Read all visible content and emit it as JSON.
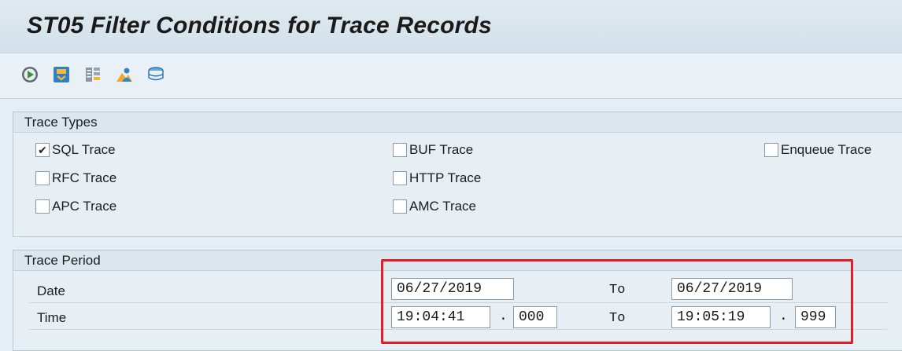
{
  "title": "ST05 Filter Conditions for Trace Records",
  "toolbar": {
    "buttons": [
      {
        "icon": "execute-icon"
      },
      {
        "icon": "save-variant-icon"
      },
      {
        "icon": "display-list-icon"
      },
      {
        "icon": "user-filter-icon"
      },
      {
        "icon": "database-icon"
      }
    ]
  },
  "trace_types": {
    "heading": "Trace Types",
    "items": [
      {
        "label": "SQL Trace",
        "checked": true
      },
      {
        "label": "RFC Trace",
        "checked": false
      },
      {
        "label": "APC Trace",
        "checked": false
      },
      {
        "label": "BUF Trace",
        "checked": false
      },
      {
        "label": "HTTP Trace",
        "checked": false
      },
      {
        "label": "AMC Trace",
        "checked": false
      },
      {
        "label": "Enqueue Trace",
        "checked": false
      }
    ]
  },
  "trace_period": {
    "heading": "Trace Period",
    "date_label": "Date",
    "time_label": "Time",
    "to_label": "To",
    "date_from": "06/27/2019",
    "date_to": "06/27/2019",
    "time_from": "19:04:41",
    "time_from_ms": "000",
    "time_to": "19:05:19",
    "time_to_ms": "999",
    "separator": "."
  },
  "colors": {
    "highlight": "#e31f26",
    "background": "#e5eef4"
  }
}
